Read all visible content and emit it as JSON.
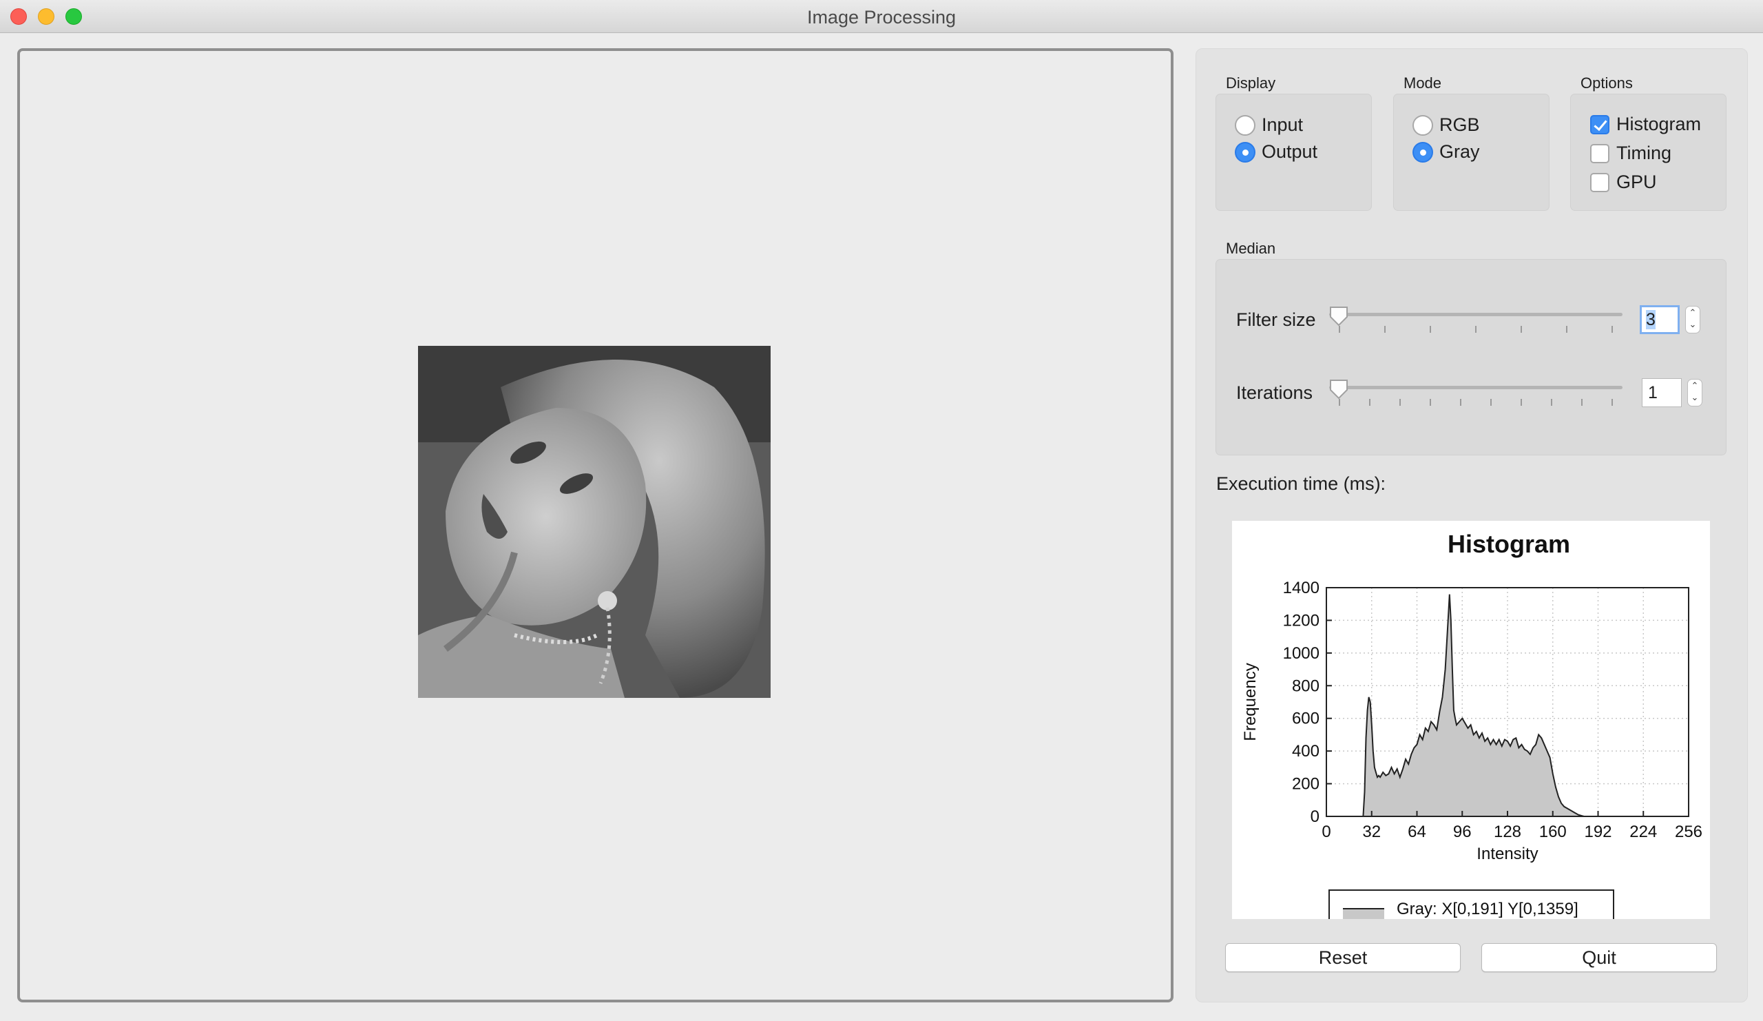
{
  "window": {
    "title": "Image Processing"
  },
  "display": {
    "label": "Display",
    "input": "Input",
    "output": "Output",
    "selected": "Output"
  },
  "mode": {
    "label": "Mode",
    "rgb": "RGB",
    "gray": "Gray",
    "selected": "Gray"
  },
  "options": {
    "label": "Options",
    "histogram": "Histogram",
    "timing": "Timing",
    "gpu": "GPU",
    "histogram_checked": true,
    "timing_checked": false,
    "gpu_checked": false
  },
  "median": {
    "label": "Median",
    "filter_size_label": "Filter size",
    "filter_size_value": "3",
    "iterations_label": "Iterations",
    "iterations_value": "1"
  },
  "execution": {
    "label": "Execution time (ms):"
  },
  "buttons": {
    "reset": "Reset",
    "quit": "Quit"
  },
  "colors": {
    "accent": "#3d8ff5",
    "hist_fill": "#c8c8c8",
    "hist_line": "#222222"
  },
  "icons": {
    "spin_arrows": "up-down-chevron-icon",
    "slider_thumb": "slider-thumb-icon"
  },
  "chart_data": {
    "type": "area",
    "title": "Histogram",
    "xlabel": "Intensity",
    "ylabel": "Frequency",
    "xlim": [
      0,
      256
    ],
    "ylim": [
      0,
      1400
    ],
    "x_ticks": [
      "0",
      "32",
      "64",
      "96",
      "128",
      "160",
      "192",
      "224",
      "256"
    ],
    "y_ticks": [
      "0",
      "200",
      "400",
      "600",
      "800",
      "1000",
      "1200",
      "1400"
    ],
    "grid": true,
    "legend": "Gray: X[0,191] Y[0,1359]",
    "series": [
      {
        "name": "Gray",
        "x": [
          0,
          26,
          27,
          28,
          29,
          30,
          31,
          32,
          33,
          34,
          35,
          36,
          37,
          38,
          40,
          42,
          44,
          46,
          48,
          50,
          52,
          54,
          56,
          58,
          60,
          62,
          64,
          66,
          68,
          70,
          72,
          74,
          76,
          78,
          80,
          82,
          84,
          86,
          87,
          88,
          89,
          90,
          91,
          92,
          94,
          96,
          98,
          100,
          102,
          104,
          106,
          108,
          110,
          112,
          114,
          116,
          118,
          120,
          122,
          124,
          126,
          128,
          130,
          132,
          134,
          136,
          138,
          140,
          142,
          144,
          146,
          148,
          150,
          152,
          154,
          156,
          158,
          160,
          162,
          164,
          166,
          168,
          170,
          172,
          174,
          176,
          178,
          180,
          182,
          184,
          186,
          188,
          190,
          191,
          256
        ],
        "y": [
          0,
          0,
          150,
          480,
          650,
          730,
          700,
          560,
          400,
          300,
          270,
          240,
          250,
          240,
          270,
          250,
          260,
          300,
          260,
          290,
          240,
          290,
          350,
          320,
          380,
          420,
          440,
          500,
          470,
          540,
          520,
          580,
          560,
          530,
          640,
          730,
          900,
          1200,
          1359,
          1200,
          900,
          650,
          600,
          560,
          580,
          600,
          570,
          540,
          560,
          500,
          520,
          480,
          510,
          460,
          480,
          440,
          470,
          440,
          470,
          430,
          470,
          460,
          430,
          470,
          480,
          420,
          440,
          410,
          400,
          380,
          420,
          440,
          500,
          480,
          440,
          400,
          360,
          260,
          180,
          120,
          80,
          60,
          50,
          40,
          30,
          20,
          10,
          5,
          0,
          0,
          0,
          0,
          0,
          0,
          0
        ]
      }
    ]
  }
}
